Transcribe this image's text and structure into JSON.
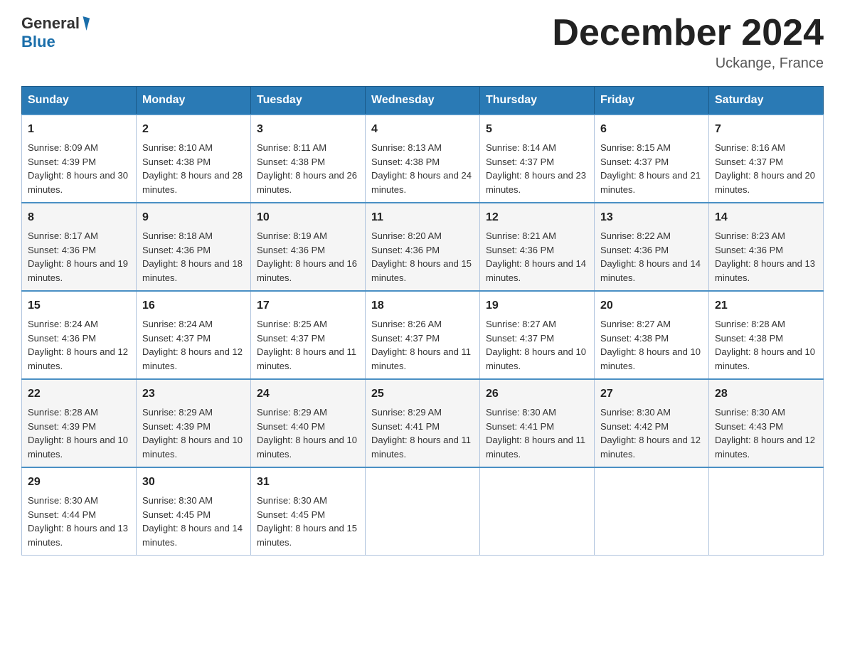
{
  "header": {
    "logo": {
      "general": "General",
      "blue": "Blue",
      "subtitle": "Blue"
    },
    "title": "December 2024",
    "location": "Uckange, France"
  },
  "weekdays": [
    "Sunday",
    "Monday",
    "Tuesday",
    "Wednesday",
    "Thursday",
    "Friday",
    "Saturday"
  ],
  "weeks": [
    [
      {
        "day": "1",
        "sunrise": "Sunrise: 8:09 AM",
        "sunset": "Sunset: 4:39 PM",
        "daylight": "Daylight: 8 hours and 30 minutes."
      },
      {
        "day": "2",
        "sunrise": "Sunrise: 8:10 AM",
        "sunset": "Sunset: 4:38 PM",
        "daylight": "Daylight: 8 hours and 28 minutes."
      },
      {
        "day": "3",
        "sunrise": "Sunrise: 8:11 AM",
        "sunset": "Sunset: 4:38 PM",
        "daylight": "Daylight: 8 hours and 26 minutes."
      },
      {
        "day": "4",
        "sunrise": "Sunrise: 8:13 AM",
        "sunset": "Sunset: 4:38 PM",
        "daylight": "Daylight: 8 hours and 24 minutes."
      },
      {
        "day": "5",
        "sunrise": "Sunrise: 8:14 AM",
        "sunset": "Sunset: 4:37 PM",
        "daylight": "Daylight: 8 hours and 23 minutes."
      },
      {
        "day": "6",
        "sunrise": "Sunrise: 8:15 AM",
        "sunset": "Sunset: 4:37 PM",
        "daylight": "Daylight: 8 hours and 21 minutes."
      },
      {
        "day": "7",
        "sunrise": "Sunrise: 8:16 AM",
        "sunset": "Sunset: 4:37 PM",
        "daylight": "Daylight: 8 hours and 20 minutes."
      }
    ],
    [
      {
        "day": "8",
        "sunrise": "Sunrise: 8:17 AM",
        "sunset": "Sunset: 4:36 PM",
        "daylight": "Daylight: 8 hours and 19 minutes."
      },
      {
        "day": "9",
        "sunrise": "Sunrise: 8:18 AM",
        "sunset": "Sunset: 4:36 PM",
        "daylight": "Daylight: 8 hours and 18 minutes."
      },
      {
        "day": "10",
        "sunrise": "Sunrise: 8:19 AM",
        "sunset": "Sunset: 4:36 PM",
        "daylight": "Daylight: 8 hours and 16 minutes."
      },
      {
        "day": "11",
        "sunrise": "Sunrise: 8:20 AM",
        "sunset": "Sunset: 4:36 PM",
        "daylight": "Daylight: 8 hours and 15 minutes."
      },
      {
        "day": "12",
        "sunrise": "Sunrise: 8:21 AM",
        "sunset": "Sunset: 4:36 PM",
        "daylight": "Daylight: 8 hours and 14 minutes."
      },
      {
        "day": "13",
        "sunrise": "Sunrise: 8:22 AM",
        "sunset": "Sunset: 4:36 PM",
        "daylight": "Daylight: 8 hours and 14 minutes."
      },
      {
        "day": "14",
        "sunrise": "Sunrise: 8:23 AM",
        "sunset": "Sunset: 4:36 PM",
        "daylight": "Daylight: 8 hours and 13 minutes."
      }
    ],
    [
      {
        "day": "15",
        "sunrise": "Sunrise: 8:24 AM",
        "sunset": "Sunset: 4:36 PM",
        "daylight": "Daylight: 8 hours and 12 minutes."
      },
      {
        "day": "16",
        "sunrise": "Sunrise: 8:24 AM",
        "sunset": "Sunset: 4:37 PM",
        "daylight": "Daylight: 8 hours and 12 minutes."
      },
      {
        "day": "17",
        "sunrise": "Sunrise: 8:25 AM",
        "sunset": "Sunset: 4:37 PM",
        "daylight": "Daylight: 8 hours and 11 minutes."
      },
      {
        "day": "18",
        "sunrise": "Sunrise: 8:26 AM",
        "sunset": "Sunset: 4:37 PM",
        "daylight": "Daylight: 8 hours and 11 minutes."
      },
      {
        "day": "19",
        "sunrise": "Sunrise: 8:27 AM",
        "sunset": "Sunset: 4:37 PM",
        "daylight": "Daylight: 8 hours and 10 minutes."
      },
      {
        "day": "20",
        "sunrise": "Sunrise: 8:27 AM",
        "sunset": "Sunset: 4:38 PM",
        "daylight": "Daylight: 8 hours and 10 minutes."
      },
      {
        "day": "21",
        "sunrise": "Sunrise: 8:28 AM",
        "sunset": "Sunset: 4:38 PM",
        "daylight": "Daylight: 8 hours and 10 minutes."
      }
    ],
    [
      {
        "day": "22",
        "sunrise": "Sunrise: 8:28 AM",
        "sunset": "Sunset: 4:39 PM",
        "daylight": "Daylight: 8 hours and 10 minutes."
      },
      {
        "day": "23",
        "sunrise": "Sunrise: 8:29 AM",
        "sunset": "Sunset: 4:39 PM",
        "daylight": "Daylight: 8 hours and 10 minutes."
      },
      {
        "day": "24",
        "sunrise": "Sunrise: 8:29 AM",
        "sunset": "Sunset: 4:40 PM",
        "daylight": "Daylight: 8 hours and 10 minutes."
      },
      {
        "day": "25",
        "sunrise": "Sunrise: 8:29 AM",
        "sunset": "Sunset: 4:41 PM",
        "daylight": "Daylight: 8 hours and 11 minutes."
      },
      {
        "day": "26",
        "sunrise": "Sunrise: 8:30 AM",
        "sunset": "Sunset: 4:41 PM",
        "daylight": "Daylight: 8 hours and 11 minutes."
      },
      {
        "day": "27",
        "sunrise": "Sunrise: 8:30 AM",
        "sunset": "Sunset: 4:42 PM",
        "daylight": "Daylight: 8 hours and 12 minutes."
      },
      {
        "day": "28",
        "sunrise": "Sunrise: 8:30 AM",
        "sunset": "Sunset: 4:43 PM",
        "daylight": "Daylight: 8 hours and 12 minutes."
      }
    ],
    [
      {
        "day": "29",
        "sunrise": "Sunrise: 8:30 AM",
        "sunset": "Sunset: 4:44 PM",
        "daylight": "Daylight: 8 hours and 13 minutes."
      },
      {
        "day": "30",
        "sunrise": "Sunrise: 8:30 AM",
        "sunset": "Sunset: 4:45 PM",
        "daylight": "Daylight: 8 hours and 14 minutes."
      },
      {
        "day": "31",
        "sunrise": "Sunrise: 8:30 AM",
        "sunset": "Sunset: 4:45 PM",
        "daylight": "Daylight: 8 hours and 15 minutes."
      },
      null,
      null,
      null,
      null
    ]
  ]
}
